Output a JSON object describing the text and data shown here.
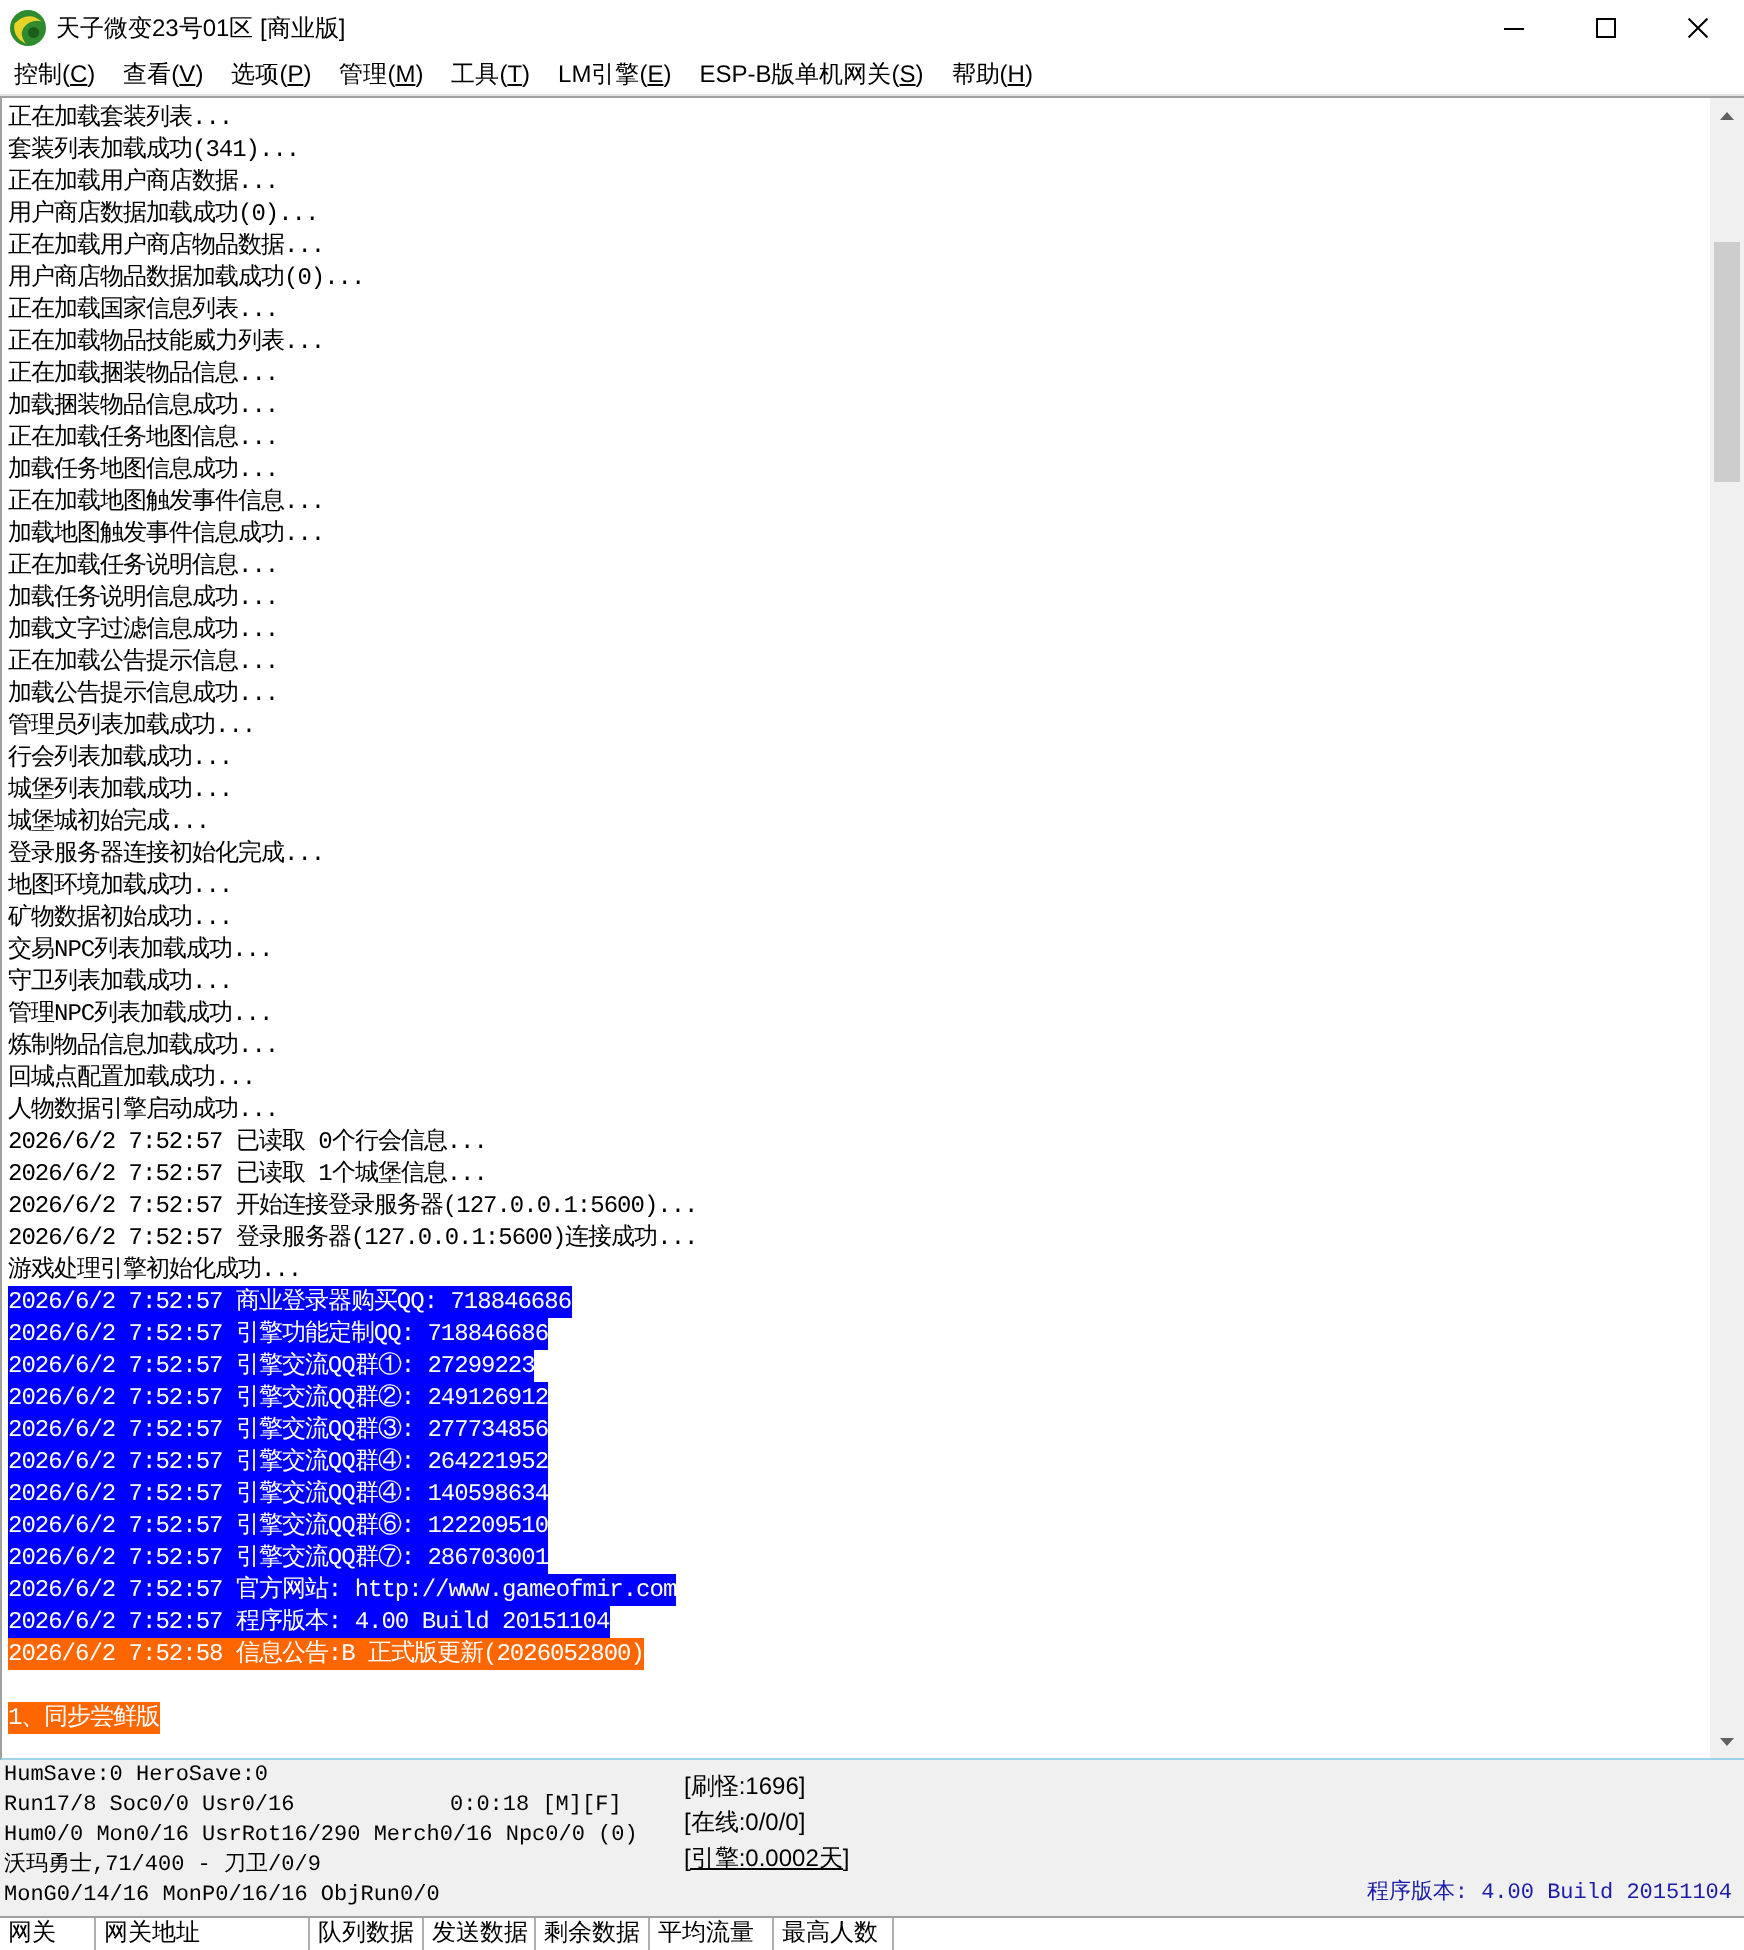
{
  "window": {
    "title": "天子微变23号01区 [商业版]"
  },
  "menu": [
    {
      "text": "控制(",
      "key": "C",
      "tail": ")"
    },
    {
      "text": "查看(",
      "key": "V",
      "tail": ")"
    },
    {
      "text": "选项(",
      "key": "P",
      "tail": ")"
    },
    {
      "text": "管理(",
      "key": "M",
      "tail": ")"
    },
    {
      "text": "工具(",
      "key": "T",
      "tail": ")"
    },
    {
      "text": "LM引擎(",
      "key": "E",
      "tail": ")"
    },
    {
      "text": "ESP-B版单机网关(",
      "key": "S",
      "tail": ")"
    },
    {
      "text": "帮助(",
      "key": "H",
      "tail": ")"
    }
  ],
  "log": {
    "lines": [
      {
        "kind": "text",
        "text": "正在加载套装列表..."
      },
      {
        "kind": "text",
        "text": "套装列表加载成功(341)..."
      },
      {
        "kind": "text",
        "text": "正在加载用户商店数据..."
      },
      {
        "kind": "text",
        "text": "用户商店数据加载成功(0)..."
      },
      {
        "kind": "text",
        "text": "正在加载用户商店物品数据..."
      },
      {
        "kind": "text",
        "text": "用户商店物品数据加载成功(0)..."
      },
      {
        "kind": "text",
        "text": "正在加载国家信息列表..."
      },
      {
        "kind": "text",
        "text": "正在加载物品技能威力列表..."
      },
      {
        "kind": "text",
        "text": "正在加载捆装物品信息..."
      },
      {
        "kind": "text",
        "text": "加载捆装物品信息成功..."
      },
      {
        "kind": "text",
        "text": "正在加载任务地图信息..."
      },
      {
        "kind": "text",
        "text": "加载任务地图信息成功..."
      },
      {
        "kind": "text",
        "text": "正在加载地图触发事件信息..."
      },
      {
        "kind": "text",
        "text": "加载地图触发事件信息成功..."
      },
      {
        "kind": "text",
        "text": "正在加载任务说明信息..."
      },
      {
        "kind": "text",
        "text": "加载任务说明信息成功..."
      },
      {
        "kind": "text",
        "text": "加载文字过滤信息成功..."
      },
      {
        "kind": "text",
        "text": "正在加载公告提示信息..."
      },
      {
        "kind": "text",
        "text": "加载公告提示信息成功..."
      },
      {
        "kind": "text",
        "text": "管理员列表加载成功..."
      },
      {
        "kind": "text",
        "text": "行会列表加载成功..."
      },
      {
        "kind": "text",
        "text": "城堡列表加载成功..."
      },
      {
        "kind": "text",
        "text": "城堡城初始完成..."
      },
      {
        "kind": "text",
        "text": "登录服务器连接初始化完成..."
      },
      {
        "kind": "text",
        "text": "地图环境加载成功..."
      },
      {
        "kind": "text",
        "text": "矿物数据初始成功..."
      },
      {
        "kind": "text",
        "text": "交易NPC列表加载成功..."
      },
      {
        "kind": "text",
        "text": "守卫列表加载成功..."
      },
      {
        "kind": "text",
        "text": "管理NPC列表加载成功..."
      },
      {
        "kind": "text",
        "text": "炼制物品信息加载成功..."
      },
      {
        "kind": "text",
        "text": "回城点配置加载成功..."
      },
      {
        "kind": "text",
        "text": "人物数据引擎启动成功..."
      },
      {
        "kind": "text",
        "text": "2026/6/2 7:52:57 已读取 0个行会信息..."
      },
      {
        "kind": "text",
        "text": "2026/6/2 7:52:57 已读取 1个城堡信息..."
      },
      {
        "kind": "text",
        "text": "2026/6/2 7:52:57 开始连接登录服务器(127.0.0.1:5600)..."
      },
      {
        "kind": "text",
        "text": "2026/6/2 7:52:57 登录服务器(127.0.0.1:5600)连接成功..."
      },
      {
        "kind": "text",
        "text": "游戏处理引擎初始化成功..."
      },
      {
        "kind": "text",
        "text": "2026/6/2 7:52:57 商业登录器购买QQ: 718846686",
        "color": "#0000ff"
      },
      {
        "kind": "text",
        "text": "2026/6/2 7:52:57 引擎功能定制QQ: 718846686",
        "color": "#0000ff"
      },
      {
        "kind": "text",
        "text": "2026/6/2 7:52:57 引擎交流QQ群①: 27299223",
        "color": "#0000ff"
      },
      {
        "kind": "text",
        "text": "2026/6/2 7:52:57 引擎交流QQ群②: 249126912",
        "color": "#0000ff"
      },
      {
        "kind": "text",
        "text": "2026/6/2 7:52:57 引擎交流QQ群③: 277734856",
        "color": "#0000ff"
      },
      {
        "kind": "text",
        "text": "2026/6/2 7:52:57 引擎交流QQ群④: 264221952",
        "color": "#0000ff"
      },
      {
        "kind": "text",
        "text": "2026/6/2 7:52:57 引擎交流QQ群④: 140598634",
        "color": "#0000ff"
      },
      {
        "kind": "text",
        "text": "2026/6/2 7:52:57 引擎交流QQ群⑥: 122209510",
        "color": "#0000ff"
      },
      {
        "kind": "text",
        "text": "2026/6/2 7:52:57 引擎交流QQ群⑦: 286703001",
        "color": "#0000ff"
      },
      {
        "kind": "text",
        "text": "2026/6/2 7:52:57 官方网站: http://www.gameofmir.com",
        "color": "#0000ff"
      },
      {
        "kind": "text",
        "text": "2026/6/2 7:52:57 程序版本: 4.00 Build 20151104",
        "color": "#0000ff"
      },
      {
        "kind": "text",
        "text": "2026/6/2 7:52:58 信息公告:B 正式版更新(2026052800)",
        "color": "#ff6600"
      },
      {
        "kind": "blank"
      },
      {
        "kind": "text",
        "text": "1、同步尝鲜版",
        "color": "#ff6600"
      }
    ]
  },
  "status": {
    "counters": [
      {
        "text": "HumSave:0 HeroSave:0"
      },
      {
        "text": "Run17/8 Soc0/0 Usr0/16",
        "timer": "0:0:18 [M][F]"
      },
      {
        "text": "Hum0/0 Mon0/16 UsrRot16/290 Merch0/16 Npc0/0 (0)"
      },
      {
        "text": "沃玛勇士,71/400 - 刀卫/0/9"
      },
      {
        "text": "MonG0/14/16 MonP0/16/16 ObjRun0/0"
      }
    ],
    "stats": [
      {
        "text": "[刷怪:1696]",
        "underlined": false
      },
      {
        "text": "[在线:0/0/0]",
        "underlined": false
      },
      {
        "text": "[引擎:0.0002天]",
        "underlined": true
      }
    ],
    "version": "程序版本: 4.00 Build 20151104"
  },
  "gateway_table": {
    "columns": [
      "网关",
      "网关地址",
      "队列数据",
      "发送数据",
      "剩余数据",
      "平均流量",
      "最高人数"
    ]
  }
}
